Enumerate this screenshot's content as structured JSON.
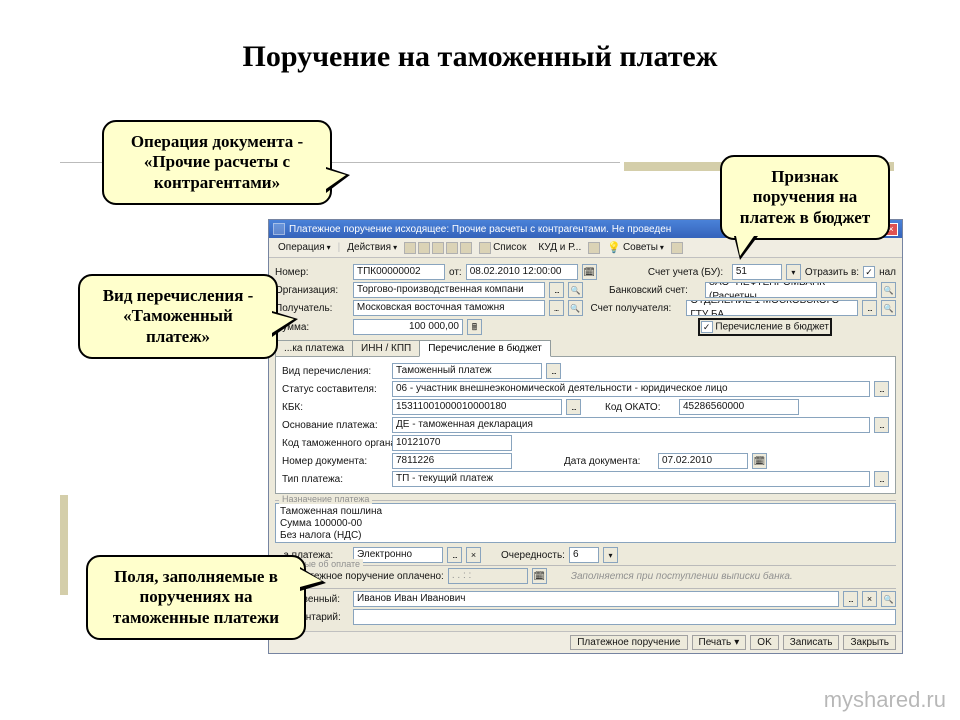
{
  "title": "Поручение на таможенный платеж",
  "callouts": {
    "c1": "Операция документа - «Прочие расчеты с контрагентами»",
    "c2": "Признак поручения на платеж в бюджет",
    "c3": "Вид перечисления - «Таможенный платеж»",
    "c4": "Поля, заполняемые в поручениях на таможенные платежи"
  },
  "window": {
    "title": "Платежное поручение исходящее: Прочие расчеты с контрагентами. Не проведен",
    "close": "×"
  },
  "toolbar": {
    "operation": "Операция",
    "actions": "Действия",
    "list": "Список",
    "kudr": "КУД и Р...",
    "tips": "Советы"
  },
  "form": {
    "number_lbl": "Номер:",
    "number": "ТПК00000002",
    "date_lbl": "от:",
    "date": "08.02.2010 12:00:00",
    "account_lbl": "Счет учета (БУ):",
    "account": "51",
    "reflect_lbl": "Отразить в:",
    "reflect_chk": "нал",
    "org_lbl": "Организация:",
    "org": "Торгово-производственная компани",
    "bank_lbl": "Банковский счет:",
    "bank": "ЗАО \"НЕФТЕПРОМБАНК\" (Расчетны",
    "recipient_lbl": "Получатель:",
    "recipient": "Московская восточная таможня",
    "recacc_lbl": "Счет получателя:",
    "recacc": "ОТДЕЛЕНИЕ 1 МОСКОВСКОГО ГТУ БА",
    "sum_lbl": "Сумма:",
    "sum": "100 000,00",
    "budget_chk": "Перечисление в бюджет"
  },
  "tabs": {
    "t1": "...ка платежа",
    "t2": "ИНН / КПП",
    "t3": "Перечисление в бюджет"
  },
  "budget": {
    "type_lbl": "Вид перечисления:",
    "type": "Таможенный платеж",
    "status_lbl": "Статус составителя:",
    "status": "06 - участник внешнеэкономической деятельности - юридическое лицо",
    "kbk_lbl": "КБК:",
    "kbk": "15311001000010000180",
    "okato_lbl": "Код ОКАТО:",
    "okato": "45286560000",
    "basis_lbl": "Основание платежа:",
    "basis": "ДЕ - таможенная декларация",
    "customs_lbl": "Код таможенного органа:",
    "customs": "10121070",
    "docnum_lbl": "Номер документа:",
    "docnum": "7811226",
    "docdate_lbl": "Дата документа:",
    "docdate": "07.02.2010",
    "paytype_lbl": "Тип платежа:",
    "paytype": "ТП - текущий платеж"
  },
  "purpose": {
    "lbl": "Назначение платежа",
    "l1": "Таможенная пошлина",
    "l2": "Сумма 100000-00",
    "l3": "Без налога (НДС)"
  },
  "extra": {
    "paykind_lbl": "...а платежа:",
    "paykind": "Электронно",
    "order_lbl": "Очередность:",
    "order": "6",
    "paid_section": "...анные об оплате",
    "paid_lbl": "Платежное поручение оплачено:",
    "paid_date": ". .   : :",
    "paid_note": "Заполняется при поступлении выписки банка.",
    "resp_lbl": "...етственный:",
    "resp": "Иванов Иван Иванович",
    "comment_lbl": "Комментарий:"
  },
  "footer": {
    "b1": "Платежное поручение",
    "b2": "Печать",
    "b3": "OK",
    "b4": "Записать",
    "b5": "Закрыть"
  },
  "watermark": "myshared.ru"
}
